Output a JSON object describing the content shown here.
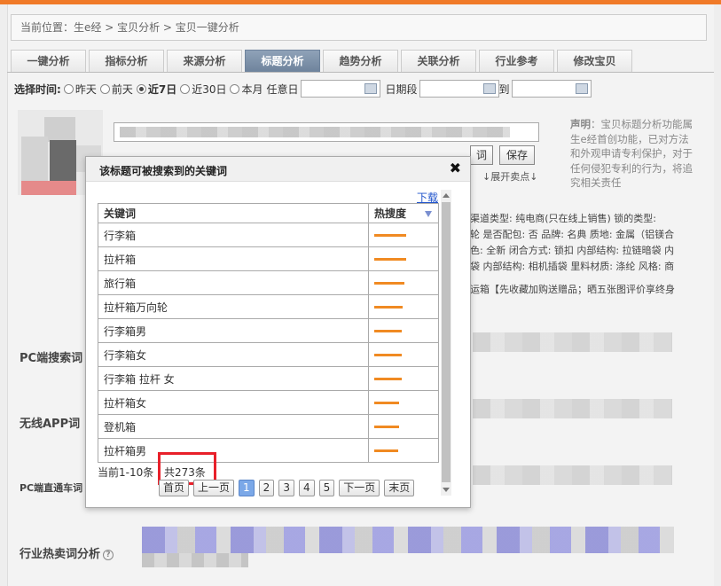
{
  "breadcrumb": "当前位置：生e经 > 宝贝分析 > 宝贝一键分析",
  "tabs": [
    {
      "label": "一键分析",
      "active": false
    },
    {
      "label": "指标分析",
      "active": false
    },
    {
      "label": "来源分析",
      "active": false
    },
    {
      "label": "标题分析",
      "active": true
    },
    {
      "label": "趋势分析",
      "active": false
    },
    {
      "label": "关联分析",
      "active": false
    },
    {
      "label": "行业参考",
      "active": false
    },
    {
      "label": "修改宝贝",
      "active": false
    }
  ],
  "time_filter": {
    "label": "选择时间:",
    "options": [
      {
        "label": "昨天",
        "checked": false
      },
      {
        "label": "前天",
        "checked": false
      },
      {
        "label": "近7日",
        "checked": true
      },
      {
        "label": "近30日",
        "checked": false
      },
      {
        "label": "本月",
        "checked": false
      }
    ],
    "custom_day_label": "任意日",
    "range_label": "日期段",
    "to_label": "到"
  },
  "product": {
    "save_label": "保存",
    "keyword_btn_label": "词",
    "expand_label": "↓展开卖点↓"
  },
  "notice": {
    "label": "声明",
    "text": "：宝贝标题分析功能属生e经首创功能，已对方法和外观申请专利保护，对于任何侵犯专利的行为，将追究相关责任"
  },
  "attributes": {
    "lines": [
      "渠道类型: 纯电商(只在线上销售)  锁的类型:",
      "轮  是否配包: 否  品牌: 名典  质地: 金属（铝镁合",
      "色: 全新  闭合方式: 锁扣  内部结构: 拉链暗袋  内",
      "袋  内部结构: 相机插袋  里料材质: 涤纶  风格: 商"
    ],
    "promo": "运箱【先收藏加购送赠品；晒五张图评价享终身"
  },
  "row_labels": {
    "pc_search": "PC端搜索词",
    "app": "无线APP词",
    "pc_direct": "PC端直通车词",
    "industry": "行业热卖词分析"
  },
  "popup": {
    "title": "该标题可被搜索到的关键词",
    "download": "下载",
    "columns": {
      "keyword": "关键词",
      "heat": "热搜度"
    },
    "rows": [
      {
        "keyword": "行李箱",
        "heat": 1.0
      },
      {
        "keyword": "拉杆箱",
        "heat": 1.0
      },
      {
        "keyword": "旅行箱",
        "heat": 0.94
      },
      {
        "keyword": "拉杆箱万向轮",
        "heat": 0.89
      },
      {
        "keyword": "行李箱男",
        "heat": 0.86
      },
      {
        "keyword": "行李箱女",
        "heat": 0.86
      },
      {
        "keyword": "行李箱 拉杆 女",
        "heat": 0.86
      },
      {
        "keyword": "拉杆箱女",
        "heat": 0.78
      },
      {
        "keyword": "登机箱",
        "heat": 0.78
      },
      {
        "keyword": "拉杆箱男",
        "heat": 0.75
      }
    ],
    "page_info": "当前1-10条",
    "total": "共273条",
    "pager": {
      "first": "首页",
      "prev": "上一页",
      "pages": [
        "1",
        "2",
        "3",
        "4",
        "5"
      ],
      "current": "1",
      "next": "下一页",
      "last": "末页"
    }
  },
  "colors": {
    "accent": "#f07a28",
    "active_tab": "#7b8fa7",
    "heat_bar": "#f08a22",
    "highlight_box": "#e8202a",
    "current_page": "#7ba8e8"
  }
}
